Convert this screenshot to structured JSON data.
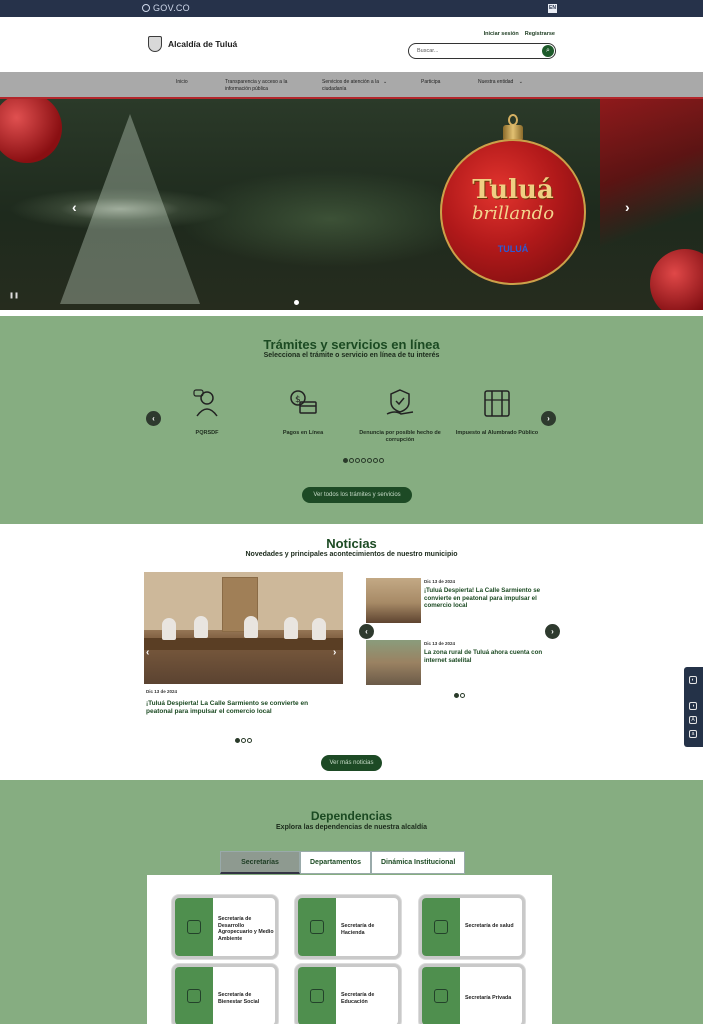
{
  "govbar": {
    "logo": "GOV.CO",
    "lang": "EN"
  },
  "header": {
    "brand": "Alcaldía de Tuluá",
    "login": "Iniciar sesión",
    "register": "Registrarse",
    "search_placeholder": "Buscar..."
  },
  "nav": {
    "items": [
      {
        "label": "Inicio"
      },
      {
        "label": "Transparencia y acceso a la información pública"
      },
      {
        "label": "Servicios de atención a la ciudadanía"
      },
      {
        "label": "Participa"
      },
      {
        "label": "Nuestra entidad"
      }
    ]
  },
  "hero": {
    "title": "Tuluá",
    "subtitle": "brillando",
    "small_word": "Está",
    "tag": "TULUÁ",
    "prev_icon": "chevron-left-icon",
    "next_icon": "chevron-right-icon",
    "active_slide": 1,
    "slide_count": 1
  },
  "tramites": {
    "title": "Trámites y servicios en línea",
    "subtitle": "Selecciona el trámite o servicio en línea de tu interés",
    "services": [
      {
        "label": "PQRSDF",
        "icon": "support-agent-icon"
      },
      {
        "label": "Pagos en Línea",
        "icon": "online-payment-icon"
      },
      {
        "label": "Denuncia por posible hecho de corrupción",
        "icon": "shield-hand-icon"
      },
      {
        "label": "Impuesto al Alumbrado Público",
        "icon": "street-light-icon"
      }
    ],
    "active_page": 1,
    "page_count": 7,
    "cta": "Ver todos los trámites y servicios"
  },
  "noticias": {
    "title": "Noticias",
    "subtitle": "Novedades y principales acontecimientos de nuestro municipio",
    "featured": {
      "date": "Dic 13 de 2024",
      "title": "¡Tuluá Despierta! La Calle Sarmiento se convierte en peatonal para impulsar el comercio local"
    },
    "featured_page": 1,
    "featured_page_count": 3,
    "side": [
      {
        "date": "Dic 13 de 2024",
        "title": "¡Tuluá Despierta! La Calle Sarmiento se convierte en peatonal para impulsar el comercio local"
      },
      {
        "date": "Dic 13 de 2024",
        "title": "La zona rural de Tuluá ahora cuenta con internet satelital"
      }
    ],
    "side_page": 1,
    "side_page_count": 2,
    "cta": "Ver más noticias"
  },
  "dependencias": {
    "title": "Dependencias",
    "subtitle": "Explora las dependencias de nuestra alcaldía",
    "tabs": [
      {
        "label": "Secretarías"
      },
      {
        "label": "Departamentos"
      },
      {
        "label": "Dinámica Institucional"
      }
    ],
    "cards": [
      {
        "label": "Secretaría de Desarrollo Agropecuario y Medio Ambiente",
        "icon": "agriculture-icon"
      },
      {
        "label": "Secretaría de Hacienda",
        "icon": "finance-icon"
      },
      {
        "label": "Secretaría de salud",
        "icon": "health-icon"
      },
      {
        "label": "Secretaría de Bienestar Social",
        "icon": "social-welfare-icon"
      },
      {
        "label": "Secretaría de Educación",
        "icon": "education-icon"
      },
      {
        "label": "Secretaría Privada",
        "icon": "government-building-icon"
      }
    ]
  },
  "floating_tools": [
    "accessibility-icon",
    "contrast-icon",
    "font-increase-icon",
    "font-decrease-icon"
  ],
  "colors": {
    "govbar": "#26324a",
    "green_bg": "#86ad81",
    "dark_green": "#1d4a25",
    "nav_border": "#b3262b"
  }
}
